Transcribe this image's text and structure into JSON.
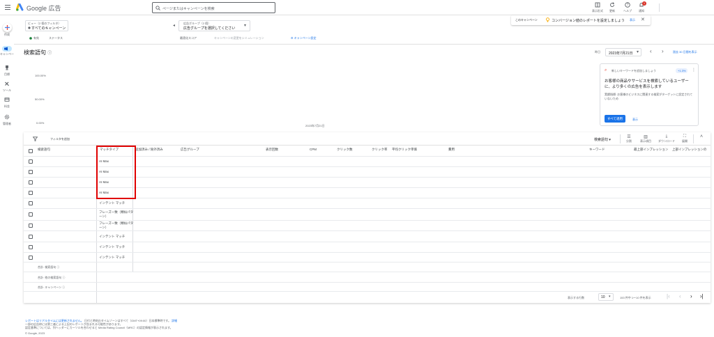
{
  "header": {
    "brand": "Google 広告",
    "search_placeholder": "ページまたはキャンペーンを検索",
    "tools": [
      {
        "name": "appearance",
        "label": "表示形式"
      },
      {
        "name": "refresh",
        "label": "更新"
      },
      {
        "name": "help",
        "label": "ヘルプ"
      },
      {
        "name": "notifications",
        "label": "通知",
        "badge": "1"
      }
    ]
  },
  "nav": {
    "items": [
      {
        "label": "作成",
        "icon": "plus-icon"
      },
      {
        "label": "キャンペーン",
        "icon": "campaign-icon"
      },
      {
        "label": "目標",
        "icon": "trophy-icon"
      },
      {
        "label": "ツール",
        "icon": "tools-icon"
      },
      {
        "label": "料金",
        "icon": "billing-icon"
      },
      {
        "label": "管理者",
        "icon": "gear-icon"
      }
    ]
  },
  "view": {
    "label": "ビュー（2 個のフィルタ）",
    "value": "すべてのキャンペーン",
    "status_enabled": "有効",
    "status_other": "ステータス"
  },
  "adgroup": {
    "label": "広告グループ（2 個）",
    "value": "広告グループを選択してください"
  },
  "toolbar": {
    "optimization": "最適化スコア",
    "simulate": "キャンペーンの変更をシミュレーション",
    "campaign_settings": "キャンペーン設定"
  },
  "notification": {
    "prefix": "このキャンペーン",
    "message": "コンバージョン値のレポートを設定しましょう",
    "link": "表示"
  },
  "page": {
    "title": "検索語句",
    "date_prefix": "昨日",
    "date": "2023年7月21日",
    "compare_link": "過去 30 日間を表示"
  },
  "chart_data": {
    "type": "line",
    "y_ticks": [
      "100.00%",
      "50.00%",
      "0.00%"
    ],
    "x_label": "2023年7月21日",
    "series": []
  },
  "recommendation": {
    "tag": "新しいキーワードを追加しましょう",
    "score": "+1.3%",
    "headline": "お客様の商品やサービスを検索しているユーザーに、より多くの広告を表示します",
    "body": "実績指標: お客様のビジネスに関連する検索がターゲットに設定されていないため",
    "apply": "すべて適用",
    "view": "表示"
  },
  "table": {
    "add_filter": "フィルタを追加",
    "segment_dropdown": "検索語句",
    "actions": [
      "分割",
      "表示項目",
      "ダウンロード",
      "展開"
    ],
    "columns_left": [
      "検索語句",
      "マッチタイプ"
    ],
    "columns_right": [
      "追加済み / 除外済み",
      "広告グループ",
      "表示回数",
      "CPM",
      "クリック数",
      "クリック率",
      "平均クリック単価",
      "費用"
    ],
    "columns_far": [
      "キーワード",
      "最上部インプレッション",
      "上部インプレッションの"
    ],
    "match_types": [
      "AI Max",
      "AI Max",
      "AI Max",
      "AI Max",
      "インテント マッチ",
      "フレーズ一致（類似パターン）",
      "フレーズ一致（類似パターン）",
      "インテント マッチ",
      "インテント マッチ",
      "インテント マッチ"
    ],
    "totals": [
      "合計: 検索語句",
      "合計: 他の検索語句",
      "合計: キャンペーン"
    ]
  },
  "pager": {
    "rows_label": "表示する行数",
    "rows_value": "10",
    "range": "153 件中 1〜10 件を表示"
  },
  "footer": {
    "line1_link": "レポートはリアルタイムには更新されません。",
    "line1": "日付と時刻のタイムゾーンはすべて（GMT+09:00）日本標準時です。",
    "line1_link2": "詳細",
    "line2": "一部の広告枠には第三者による上記のレポートが含まれる可能性があります。",
    "line3": "認定基準については、列ヘッダーにカーソルを合わせると Media Rating Council（MRC）の認定情報が表示されます。",
    "copyright": "© Google, 2023"
  }
}
